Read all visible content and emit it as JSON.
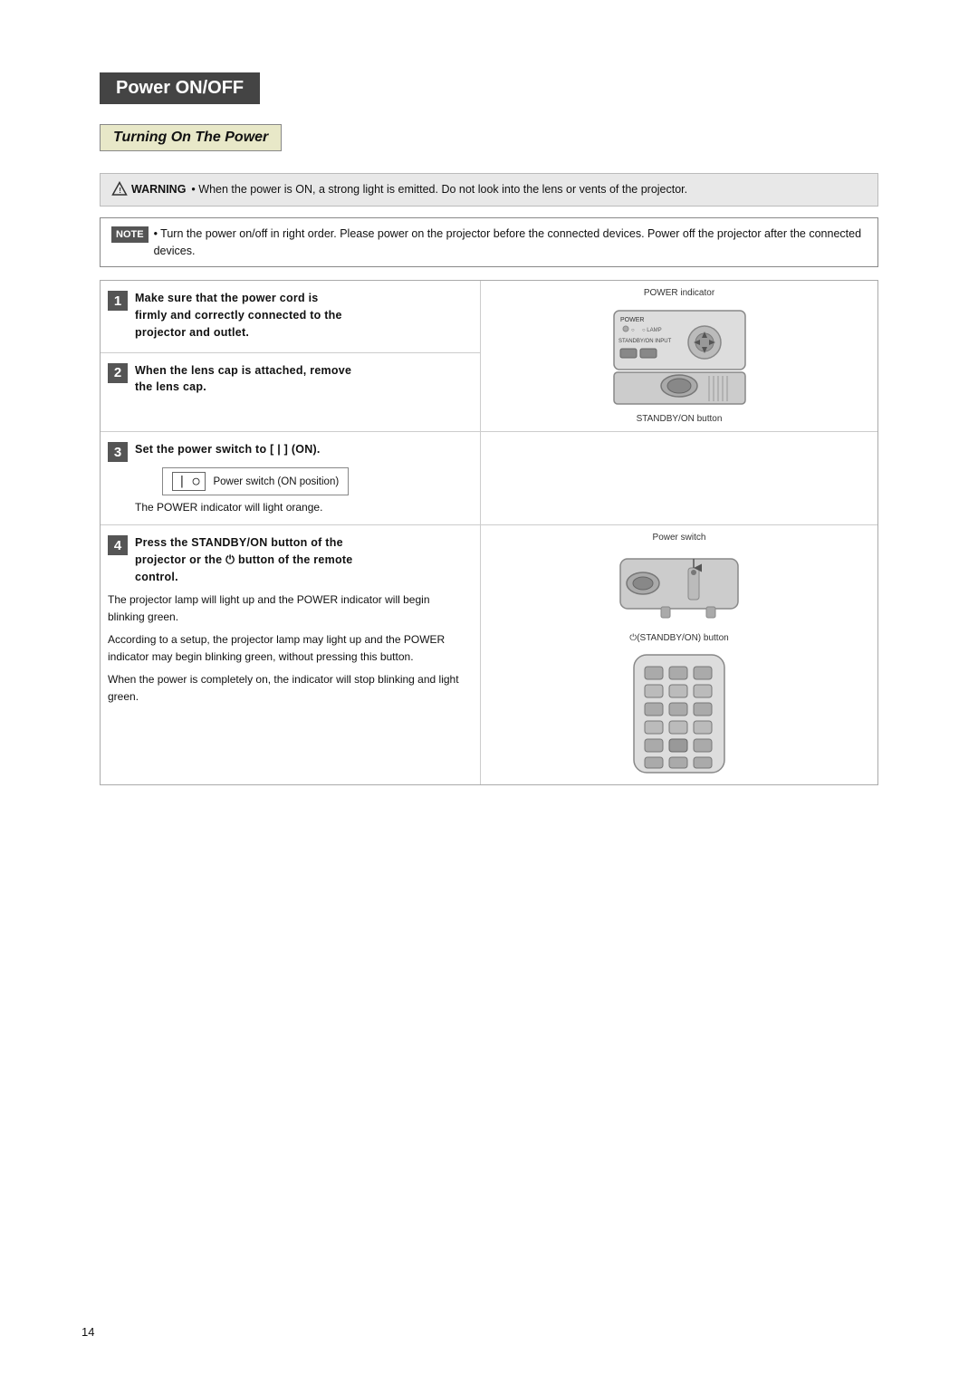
{
  "page": {
    "number": "14",
    "section_title": "Power ON/OFF",
    "subsection_title": "Turning On The Power",
    "warning": {
      "label": "WARNING",
      "text": "• When the power is ON, a strong light is emitted. Do not look into the lens or vents of the projector."
    },
    "note": {
      "label": "NOTE",
      "text": "• Turn the power on/off in right order. Please power on the projector before the connected devices. Power off the projector after the connected devices."
    },
    "steps": [
      {
        "number": "1",
        "heading": "Make sure that the power cord is firmly and correctly connected to the projector and outlet.",
        "detail": "",
        "diagram_label": "POWER indicator",
        "diagram2_label": "STANDBY/ON button"
      },
      {
        "number": "2",
        "heading": "When the lens cap is attached, remove the lens cap.",
        "detail": ""
      },
      {
        "number": "3",
        "heading": "Set the power switch to [ | ] (ON).",
        "detail": "The POWER indicator will light orange.",
        "switch_label": "Power switch (ON position)"
      },
      {
        "number": "4",
        "heading": "Press the STANDBY/ON button of the projector or the ⏻ button of the remote control.",
        "detail1": "The projector lamp will light up and the POWER indicator will begin blinking green.",
        "detail2": "According to a setup, the projector lamp may light up and the POWER indicator may begin blinking green, without pressing this button.",
        "detail3": "When the power is completely on, the indicator will stop blinking and light green.",
        "diagram_label": "Power switch",
        "diagram2_label": "⏻(STANDBY/ON) button"
      }
    ]
  }
}
